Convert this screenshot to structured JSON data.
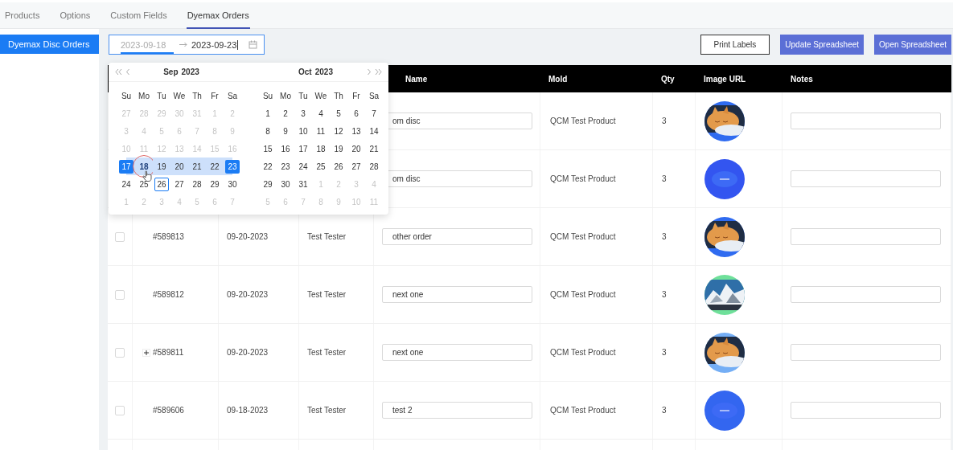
{
  "tabs": [
    {
      "label": "Products",
      "selected": false
    },
    {
      "label": "Options",
      "selected": false
    },
    {
      "label": "Custom Fields",
      "selected": false
    },
    {
      "label": "Dyemax Orders",
      "selected": true
    }
  ],
  "sidebar": {
    "items": [
      {
        "label": "Dyemax Disc Orders",
        "selected": true
      }
    ]
  },
  "date_range": {
    "start": {
      "value": "2023-09-18",
      "active": true
    },
    "end": {
      "value": "2023-09-23",
      "active": false
    }
  },
  "buttons": [
    {
      "label": "Print Labels",
      "kind": "outline"
    },
    {
      "label": "Update Spreadsheet",
      "kind": "primary"
    },
    {
      "label": "Open Spreadsheet",
      "kind": "primary"
    }
  ],
  "calendar": {
    "months": [
      {
        "month": "Sep",
        "year": "2023",
        "weekdays": [
          "Su",
          "Mo",
          "Tu",
          "We",
          "Th",
          "Fr",
          "Sa"
        ],
        "weeks": [
          [
            {
              "d": "27",
              "kind": "muted"
            },
            {
              "d": "28",
              "kind": "muted"
            },
            {
              "d": "29",
              "kind": "muted"
            },
            {
              "d": "30",
              "kind": "muted"
            },
            {
              "d": "31",
              "kind": "muted"
            },
            {
              "d": "1",
              "kind": "muted"
            },
            {
              "d": "2",
              "kind": "muted"
            }
          ],
          [
            {
              "d": "3",
              "kind": "muted"
            },
            {
              "d": "4",
              "kind": "muted"
            },
            {
              "d": "5",
              "kind": "muted"
            },
            {
              "d": "6",
              "kind": "muted"
            },
            {
              "d": "7",
              "kind": "muted"
            },
            {
              "d": "8",
              "kind": "muted"
            },
            {
              "d": "9",
              "kind": "muted"
            }
          ],
          [
            {
              "d": "10",
              "kind": "muted"
            },
            {
              "d": "11",
              "kind": "muted"
            },
            {
              "d": "12",
              "kind": "muted"
            },
            {
              "d": "13",
              "kind": "muted"
            },
            {
              "d": "14",
              "kind": "muted"
            },
            {
              "d": "15",
              "kind": "muted"
            },
            {
              "d": "16",
              "kind": "muted"
            }
          ],
          [
            {
              "d": "17",
              "kind": "start"
            },
            {
              "d": "18",
              "kind": "hover"
            },
            {
              "d": "19",
              "kind": "range"
            },
            {
              "d": "20",
              "kind": "range"
            },
            {
              "d": "21",
              "kind": "range"
            },
            {
              "d": "22",
              "kind": "range"
            },
            {
              "d": "23",
              "kind": "end"
            }
          ],
          [
            {
              "d": "24",
              "kind": "normal"
            },
            {
              "d": "25",
              "kind": "normal"
            },
            {
              "d": "26",
              "kind": "today"
            },
            {
              "d": "27",
              "kind": "normal"
            },
            {
              "d": "28",
              "kind": "normal"
            },
            {
              "d": "29",
              "kind": "normal"
            },
            {
              "d": "30",
              "kind": "normal"
            }
          ],
          [
            {
              "d": "1",
              "kind": "muted"
            },
            {
              "d": "2",
              "kind": "muted"
            },
            {
              "d": "3",
              "kind": "muted"
            },
            {
              "d": "4",
              "kind": "muted"
            },
            {
              "d": "5",
              "kind": "muted"
            },
            {
              "d": "6",
              "kind": "muted"
            },
            {
              "d": "7",
              "kind": "muted"
            }
          ]
        ]
      },
      {
        "month": "Oct",
        "year": "2023",
        "weekdays": [
          "Su",
          "Mo",
          "Tu",
          "We",
          "Th",
          "Fr",
          "Sa"
        ],
        "weeks": [
          [
            {
              "d": "1",
              "kind": "normal"
            },
            {
              "d": "2",
              "kind": "normal"
            },
            {
              "d": "3",
              "kind": "normal"
            },
            {
              "d": "4",
              "kind": "normal"
            },
            {
              "d": "5",
              "kind": "normal"
            },
            {
              "d": "6",
              "kind": "normal"
            },
            {
              "d": "7",
              "kind": "normal"
            }
          ],
          [
            {
              "d": "8",
              "kind": "normal"
            },
            {
              "d": "9",
              "kind": "normal"
            },
            {
              "d": "10",
              "kind": "normal"
            },
            {
              "d": "11",
              "kind": "normal"
            },
            {
              "d": "12",
              "kind": "normal"
            },
            {
              "d": "13",
              "kind": "normal"
            },
            {
              "d": "14",
              "kind": "normal"
            }
          ],
          [
            {
              "d": "15",
              "kind": "normal"
            },
            {
              "d": "16",
              "kind": "normal"
            },
            {
              "d": "17",
              "kind": "normal"
            },
            {
              "d": "18",
              "kind": "normal"
            },
            {
              "d": "19",
              "kind": "normal"
            },
            {
              "d": "20",
              "kind": "normal"
            },
            {
              "d": "21",
              "kind": "normal"
            }
          ],
          [
            {
              "d": "22",
              "kind": "normal"
            },
            {
              "d": "23",
              "kind": "normal"
            },
            {
              "d": "24",
              "kind": "normal"
            },
            {
              "d": "25",
              "kind": "normal"
            },
            {
              "d": "26",
              "kind": "normal"
            },
            {
              "d": "27",
              "kind": "normal"
            },
            {
              "d": "28",
              "kind": "normal"
            }
          ],
          [
            {
              "d": "29",
              "kind": "normal"
            },
            {
              "d": "30",
              "kind": "normal"
            },
            {
              "d": "31",
              "kind": "normal"
            },
            {
              "d": "1",
              "kind": "muted"
            },
            {
              "d": "2",
              "kind": "muted"
            },
            {
              "d": "3",
              "kind": "muted"
            },
            {
              "d": "4",
              "kind": "muted"
            }
          ],
          [
            {
              "d": "5",
              "kind": "muted"
            },
            {
              "d": "6",
              "kind": "muted"
            },
            {
              "d": "7",
              "kind": "muted"
            },
            {
              "d": "8",
              "kind": "muted"
            },
            {
              "d": "9",
              "kind": "muted"
            },
            {
              "d": "10",
              "kind": "muted"
            },
            {
              "d": "11",
              "kind": "muted"
            }
          ]
        ]
      }
    ]
  },
  "table": {
    "columns": [
      "Name",
      "Mold",
      "Qty",
      "Image URL",
      "Notes"
    ],
    "rows": [
      {
        "name": "om disc",
        "mold": "QCM Test Product",
        "qty": "3"
      },
      {
        "name": "om disc",
        "mold": "QCM Test Product",
        "qty": "3"
      },
      {
        "checked": false,
        "expandable": false,
        "order": "#589813",
        "date": "09-20-2023",
        "customer": "Test Tester",
        "name": "other order",
        "mold": "QCM Test Product",
        "qty": "3"
      },
      {
        "checked": false,
        "expandable": false,
        "order": "#589812",
        "date": "09-20-2023",
        "customer": "Test Tester",
        "name": "next one",
        "mold": "QCM Test Product",
        "qty": "3"
      },
      {
        "checked": false,
        "expandable": true,
        "order": "#589811",
        "date": "09-20-2023",
        "customer": "Test Tester",
        "name": "next one",
        "mold": "QCM Test Product",
        "qty": "3"
      },
      {
        "checked": false,
        "expandable": false,
        "order": "#589606",
        "date": "09-18-2023",
        "customer": "Test Tester",
        "name": "test 2",
        "mold": "QCM Test Product",
        "qty": "3"
      }
    ]
  }
}
